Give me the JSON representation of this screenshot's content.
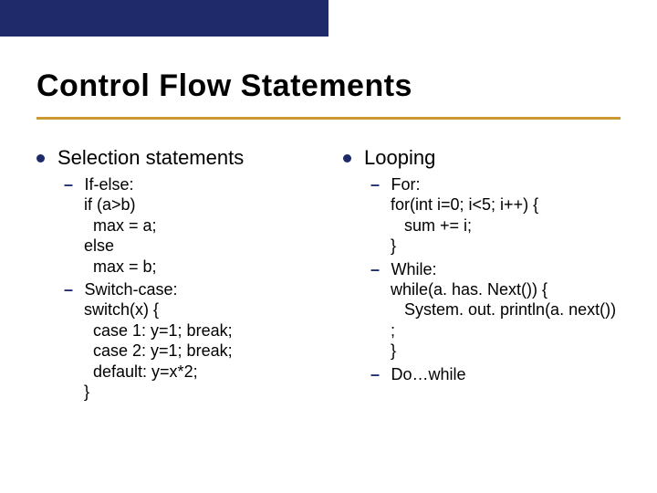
{
  "slide": {
    "title": "Control Flow Statements",
    "left": {
      "heading": "Selection statements",
      "items": [
        {
          "head": "If-else:",
          "lines": [
            "if (a>b)",
            "  max = a;",
            "else",
            "  max = b;"
          ]
        },
        {
          "head": "Switch-case:",
          "lines": [
            "switch(x) {",
            "  case 1: y=1; break;",
            "  case 2: y=1; break;",
            "  default: y=x*2;",
            "}"
          ]
        }
      ]
    },
    "right": {
      "heading": "Looping",
      "items": [
        {
          "head": "For:",
          "lines": [
            "for(int i=0; i<5; i++) {",
            "   sum += i;",
            "}"
          ]
        },
        {
          "head": "While:",
          "lines": [
            "while(a. has. Next()) {",
            "   System. out. println(a. next())",
            ";",
            "}"
          ]
        },
        {
          "head": "Do…while",
          "lines": []
        }
      ]
    }
  }
}
